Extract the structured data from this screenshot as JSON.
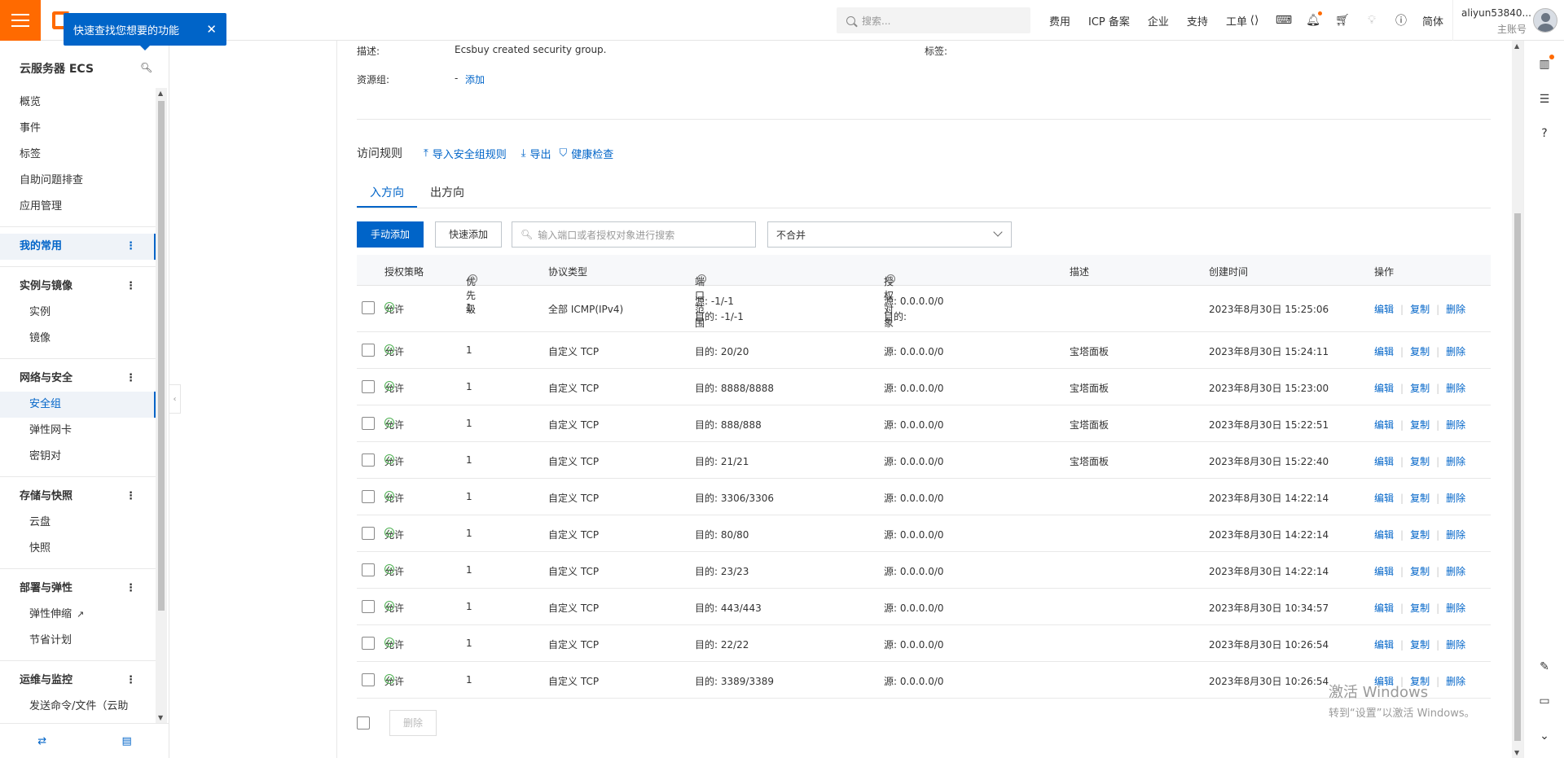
{
  "topbar": {
    "search_placeholder": "搜索...",
    "nav": [
      "费用",
      "ICP 备案",
      "企业",
      "支持",
      "工单"
    ],
    "lang": "简体",
    "account_name": "aliyun53840...",
    "account_role": "主账号"
  },
  "tooltip": {
    "text": "快速查找您想要的功能",
    "close": "✕"
  },
  "sidebar": {
    "title": "云服务器 ECS",
    "items": [
      {
        "label": "概览",
        "type": "top"
      },
      {
        "label": "事件",
        "type": "top"
      },
      {
        "label": "标签",
        "type": "top"
      },
      {
        "label": "自助问题排查",
        "type": "top"
      },
      {
        "label": "应用管理",
        "type": "top"
      },
      {
        "sep": true
      },
      {
        "label": "我的常用",
        "type": "group",
        "active": true
      },
      {
        "sep": true
      },
      {
        "label": "实例与镜像",
        "type": "group"
      },
      {
        "label": "实例",
        "type": "sub"
      },
      {
        "label": "镜像",
        "type": "sub"
      },
      {
        "sep": true
      },
      {
        "label": "网络与安全",
        "type": "group"
      },
      {
        "label": "安全组",
        "type": "sub",
        "active": true
      },
      {
        "label": "弹性网卡",
        "type": "sub"
      },
      {
        "label": "密钥对",
        "type": "sub"
      },
      {
        "sep": true
      },
      {
        "label": "存储与快照",
        "type": "group"
      },
      {
        "label": "云盘",
        "type": "sub"
      },
      {
        "label": "快照",
        "type": "sub"
      },
      {
        "sep": true
      },
      {
        "label": "部署与弹性",
        "type": "group"
      },
      {
        "label": "弹性伸缩",
        "type": "sub",
        "external": true
      },
      {
        "label": "节省计划",
        "type": "sub"
      },
      {
        "sep": true
      },
      {
        "label": "运维与监控",
        "type": "group"
      },
      {
        "label": "发送命令/文件（云助",
        "type": "sub"
      }
    ]
  },
  "details": {
    "desc_label": "描述:",
    "desc_value": "Ecsbuy created security group.",
    "tag_label": "标签:",
    "rg_label": "资源组:",
    "rg_value": "-",
    "rg_add": "添加"
  },
  "rules": {
    "title": "访问规则",
    "import": "导入安全组规则",
    "export": "导出",
    "health": "健康检查"
  },
  "tabs": [
    "入方向",
    "出方向"
  ],
  "toolbar": {
    "manual_add": "手动添加",
    "quick_add": "快速添加",
    "search_placeholder": "输入端口或者授权对象进行搜索",
    "merge_select": "不合并"
  },
  "table": {
    "headers": [
      "授权策略",
      "优先级",
      "协议类型",
      "端口范围",
      "授权对象",
      "描述",
      "创建时间",
      "操作"
    ],
    "ops": [
      "编辑",
      "复制",
      "删除"
    ],
    "rows": [
      {
        "policy": "允许",
        "priority": "1",
        "protocol": "全部 ICMP(IPv4)",
        "port": "源: -1/-1",
        "port2": "目的: -1/-1",
        "auth": "源: 0.0.0.0/0",
        "auth2": "目的:",
        "desc": "",
        "time": "2023年8月30日 15:25:06"
      },
      {
        "policy": "允许",
        "priority": "1",
        "protocol": "自定义 TCP",
        "port": "目的: 20/20",
        "auth": "源: 0.0.0.0/0",
        "desc": "宝塔面板",
        "time": "2023年8月30日 15:24:11"
      },
      {
        "policy": "允许",
        "priority": "1",
        "protocol": "自定义 TCP",
        "port": "目的: 8888/8888",
        "auth": "源: 0.0.0.0/0",
        "desc": "宝塔面板",
        "time": "2023年8月30日 15:23:00"
      },
      {
        "policy": "允许",
        "priority": "1",
        "protocol": "自定义 TCP",
        "port": "目的: 888/888",
        "auth": "源: 0.0.0.0/0",
        "desc": "宝塔面板",
        "time": "2023年8月30日 15:22:51"
      },
      {
        "policy": "允许",
        "priority": "1",
        "protocol": "自定义 TCP",
        "port": "目的: 21/21",
        "auth": "源: 0.0.0.0/0",
        "desc": "宝塔面板",
        "time": "2023年8月30日 15:22:40"
      },
      {
        "policy": "允许",
        "priority": "1",
        "protocol": "自定义 TCP",
        "port": "目的: 3306/3306",
        "auth": "源: 0.0.0.0/0",
        "desc": "",
        "time": "2023年8月30日 14:22:14"
      },
      {
        "policy": "允许",
        "priority": "1",
        "protocol": "自定义 TCP",
        "port": "目的: 80/80",
        "auth": "源: 0.0.0.0/0",
        "desc": "",
        "time": "2023年8月30日 14:22:14"
      },
      {
        "policy": "允许",
        "priority": "1",
        "protocol": "自定义 TCP",
        "port": "目的: 23/23",
        "auth": "源: 0.0.0.0/0",
        "desc": "",
        "time": "2023年8月30日 14:22:14"
      },
      {
        "policy": "允许",
        "priority": "1",
        "protocol": "自定义 TCP",
        "port": "目的: 443/443",
        "auth": "源: 0.0.0.0/0",
        "desc": "",
        "time": "2023年8月30日 10:34:57"
      },
      {
        "policy": "允许",
        "priority": "1",
        "protocol": "自定义 TCP",
        "port": "目的: 22/22",
        "auth": "源: 0.0.0.0/0",
        "desc": "",
        "time": "2023年8月30日 10:26:54"
      },
      {
        "policy": "允许",
        "priority": "1",
        "protocol": "自定义 TCP",
        "port": "目的: 3389/3389",
        "auth": "源: 0.0.0.0/0",
        "desc": "",
        "time": "2023年8月30日 10:26:54"
      }
    ]
  },
  "footer": {
    "delete": "删除"
  },
  "watermark": {
    "line1": "激活 Windows",
    "line2": "转到“设置”以激活 Windows。"
  }
}
